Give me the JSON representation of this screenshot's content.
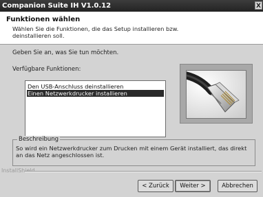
{
  "window": {
    "title": "Companion Suite IH V1.0.12",
    "close_glyph": "X"
  },
  "header": {
    "heading": "Funktionen wählen",
    "description": "Wählen Sie die Funktionen, die das Setup installieren bzw. deinstallieren soll."
  },
  "prompt": "Geben Sie an, was Sie tun möchten.",
  "features": {
    "label": "Verfügbare Funktionen:",
    "items": [
      {
        "label": "Den USB-Anschluss deinstallieren",
        "selected": false
      },
      {
        "label": "Einen Netzwerkdrucker installieren",
        "selected": true
      }
    ]
  },
  "illustration": {
    "icon": "network-cable-plug-icon"
  },
  "description_group": {
    "legend": "Beschreibung",
    "text": "So wird ein Netzwerkdrucker zum Drucken mit einem Gerät installiert, das direkt an das Netz angeschlossen ist."
  },
  "brand": "InstallShield",
  "buttons": {
    "back": "< Zurück",
    "next": "Weiter >",
    "cancel": "Abbrechen"
  }
}
